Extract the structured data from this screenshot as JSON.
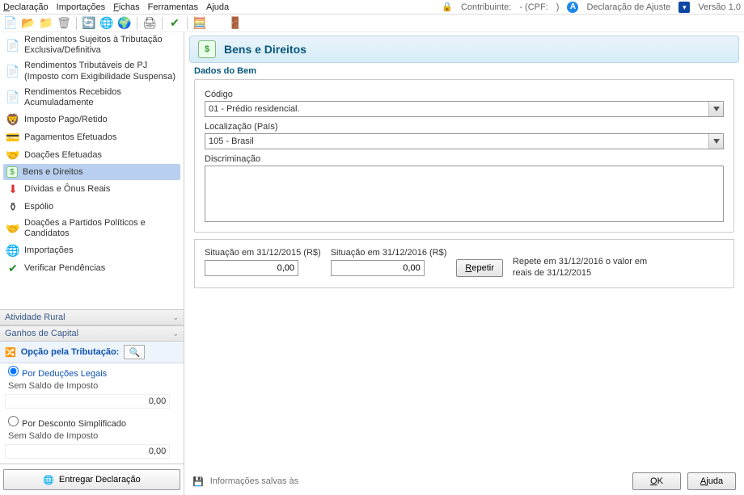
{
  "menu": {
    "declaracao": "Declaração",
    "importacoes": "Importações",
    "fichas": "Fichas",
    "ferramentas": "Ferramentas",
    "ajuda": "Ajuda"
  },
  "statusbar": {
    "contribuinte_label": "Contribuinte:",
    "cpf_label": "- (CPF:",
    "cpf_close": ")",
    "decl_ajuste": "Declaração de Ajuste",
    "versao": "Versão 1.0"
  },
  "sidebar": {
    "items": [
      {
        "icon": "📄",
        "label": "Rendimentos Sujeitos à Tributação Exclusiva/Definitiva"
      },
      {
        "icon": "📄",
        "label": "Rendimentos Tributáveis de PJ (Imposto com Exigibilidade Suspensa)"
      },
      {
        "icon": "📄",
        "label": "Rendimentos Recebidos Acumuladamente"
      },
      {
        "icon": "🦁",
        "label": "Imposto Pago/Retido"
      },
      {
        "icon": "💳",
        "label": "Pagamentos Efetuados"
      },
      {
        "icon": "🤝",
        "label": "Doações Efetuadas"
      },
      {
        "icon": "$",
        "label": "Bens e Direitos"
      },
      {
        "icon": "⬇",
        "label": "Dívidas e Ônus Reais"
      },
      {
        "icon": "⚰",
        "label": "Espólio"
      },
      {
        "icon": "🤝",
        "label": "Doações a Partidos Políticos e Candidatos"
      },
      {
        "icon": "🌐",
        "label": "Importações"
      },
      {
        "icon": "✔",
        "label": "Verificar Pendências"
      }
    ],
    "panel_rural": "Atividade Rural",
    "panel_ganhos": "Ganhos de Capital",
    "tax_option_label": "Opção pela Tributação:",
    "radio_deducoes": "Por Deduções Legais",
    "radio_simpl": "Por Desconto Simplificado",
    "sem_saldo": "Sem Saldo de Imposto",
    "valor_zero": "0,00",
    "entregar": "Entregar Declaração"
  },
  "content": {
    "title": "Bens e Direitos",
    "section": "Dados do Bem",
    "codigo_label": "Código",
    "codigo_value": "01 - Prédio residencial.",
    "loc_label": "Localização (País)",
    "loc_value": "105 - Brasil",
    "discr_label": "Discriminação",
    "sit2015_label": "Situação em 31/12/2015 (R$)",
    "sit2016_label": "Situação em 31/12/2016 (R$)",
    "sit_value": "0,00",
    "repetir": "Repetir",
    "repetir_hint": "Repete em 31/12/2016 o valor em reais de 31/12/2015"
  },
  "footer": {
    "saved": "Informações salvas às",
    "ok": "OK",
    "ajuda": "Ajuda"
  }
}
